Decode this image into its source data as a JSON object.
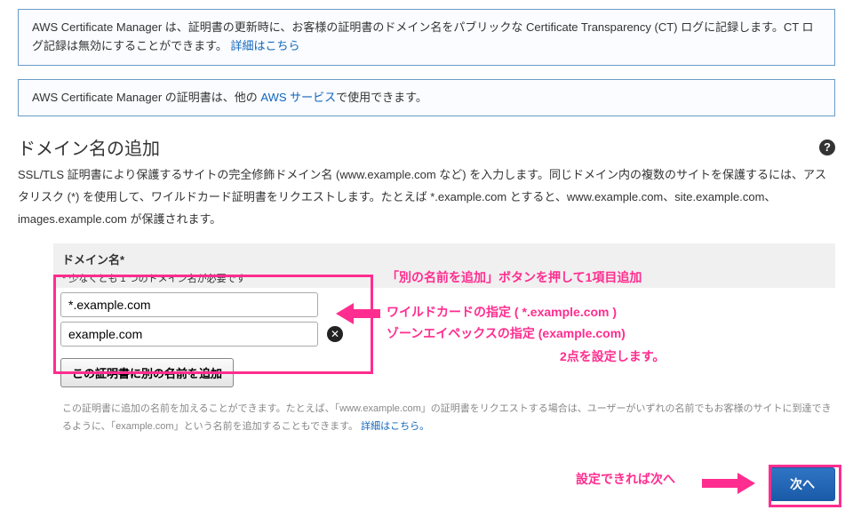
{
  "info1": {
    "text_part1": "AWS Certificate Manager は、証明書の更新時に、お客様の証明書のドメイン名をパブリックな Certificate Transparency (CT) ログに記録します。CT ログ記録は無効にすることができます。",
    "link": "詳細はこちら"
  },
  "info2": {
    "text_part1": "AWS Certificate Manager の証明書は、他の ",
    "link": "AWS サービス",
    "text_part2": "で使用できます。"
  },
  "section": {
    "title": "ドメイン名の追加",
    "desc": "SSL/TLS 証明書により保護するサイトの完全修飾ドメイン名 (www.example.com など) を入力します。同じドメイン内の複数のサイトを保護するには、アスタリスク (*) を使用して、ワイルドカード証明書をリクエストします。たとえば *.example.com とすると、www.example.com、site.example.com、images.example.com が保護されます。"
  },
  "form": {
    "header": "ドメイン名*",
    "note": "* 少なくとも 1 つのドメイン名が必要です",
    "input1": "*.example.com",
    "input2": "example.com",
    "add_btn": "この証明書に別の名前を追加"
  },
  "footnote": {
    "text1": "この証明書に追加の名前を加えることができます。たとえば、「www.example.com」の証明書をリクエストする場合は、ユーザーがいずれの名前でもお客様のサイトに到達できるように、「example.com」という名前を追加することもできます。",
    "link": "詳細はこちら。"
  },
  "annotations": {
    "line1": "「別の名前を追加」ボタンを押して1項目追加",
    "line2": "ワイルドカードの指定 ( *.example.com )",
    "line3": "ゾーンエイペックスの指定 (example.com)",
    "line4": "2点を設定します。",
    "bottom": "設定できれば次へ"
  },
  "buttons": {
    "next": "次へ"
  }
}
